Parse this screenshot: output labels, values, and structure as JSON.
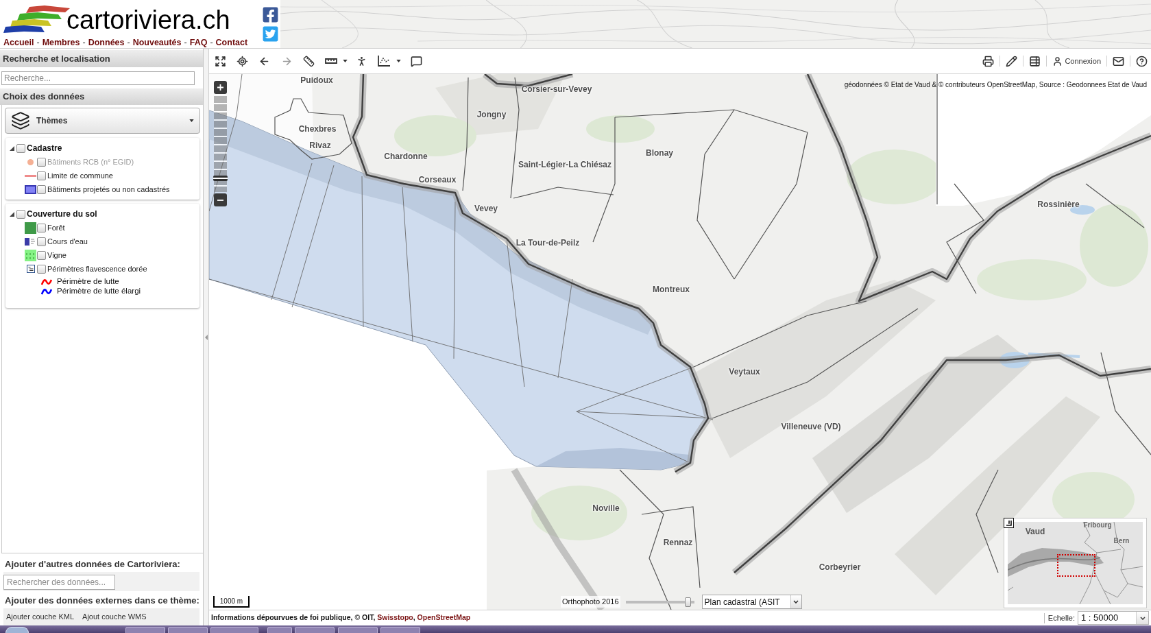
{
  "header": {
    "site_title": "cartoriviera.ch",
    "nav": [
      {
        "kind": "link",
        "label": "Accueil"
      },
      {
        "kind": "separator",
        "label": "-"
      },
      {
        "kind": "link",
        "label": "Membres"
      },
      {
        "kind": "separator",
        "label": "-"
      },
      {
        "kind": "link",
        "label": "Données"
      },
      {
        "kind": "separator",
        "label": "-"
      },
      {
        "kind": "link",
        "label": "Nouveautés"
      },
      {
        "kind": "separator",
        "label": "-"
      },
      {
        "kind": "link",
        "label": "FAQ"
      },
      {
        "kind": "separator",
        "label": "-"
      },
      {
        "kind": "link",
        "label": "Contact"
      }
    ]
  },
  "sidebar": {
    "search_panel": {
      "title": "Recherche et localisation",
      "search": {
        "placeholder": "Recherche..."
      }
    },
    "data_panel": {
      "title": "Choix des données",
      "themes_button": "Thèmes",
      "groups": [
        {
          "label": "Cadastre",
          "checked": false,
          "expanded": true,
          "children": [
            {
              "kind": "dot",
              "label": "Bâtiments RCB (n° EGID)",
              "color": "#f5b094",
              "checked": false,
              "disabled": true
            },
            {
              "kind": "line",
              "label": "Limite de commune",
              "color": "#ef8c8c",
              "checked": false,
              "disabled": false
            },
            {
              "kind": "outlined_fill",
              "label": "Bâtiments projetés ou non cadastrés",
              "color": "#8282f5",
              "checked": false,
              "disabled": false
            }
          ]
        },
        {
          "label": "Couverture du sol",
          "checked": false,
          "expanded": true,
          "children": [
            {
              "kind": "fill",
              "label": "Forêt",
              "color": "#3f9a48",
              "checked": false,
              "disabled": false
            },
            {
              "kind": "water",
              "label": "Cours d'eau",
              "color": "#3c3ca8",
              "checked": false,
              "disabled": false
            },
            {
              "kind": "vine",
              "label": "Vigne",
              "color": "#85f285",
              "checked": false,
              "disabled": false
            },
            {
              "kind": "legend",
              "label": "Périmètres flavescence dorée",
              "checked": false,
              "disabled": false,
              "children": [
                {
                  "label": "Périmètre de lutte",
                  "color": "#ff0000"
                },
                {
                  "label": "Périmètre de lutte élargi",
                  "color": "#0000ff"
                }
              ]
            }
          ]
        }
      ]
    },
    "add_data": {
      "title": "Ajouter d'autres données de Cartoriviera:",
      "search": {
        "placeholder": "Rechercher des données..."
      }
    },
    "external_data": {
      "title": "Ajouter des données externes dans ce thème:",
      "buttons": [
        "Ajouter couche KML",
        "Ajout couche WMS"
      ]
    }
  },
  "toolbar": {
    "login": "Connexion"
  },
  "map": {
    "attribution": "géodonnées © Etat de Vaud & © contributeurs OpenStreetMap, Source : Geodonnees Etat de Vaud",
    "zoom": {
      "level": 0.12
    },
    "place_labels": [
      {
        "name": "Puidoux"
      },
      {
        "name": "Corsier-sur-Vevey"
      },
      {
        "name": "Jongny"
      },
      {
        "name": "Chexbres"
      },
      {
        "name": "Blonay"
      },
      {
        "name": "Chardonne"
      },
      {
        "name": "Rivaz"
      },
      {
        "name": "Saint-Légier-La Chiésaz"
      },
      {
        "name": "Corseaux"
      },
      {
        "name": "Rossinière"
      },
      {
        "name": "Vevey"
      },
      {
        "name": "La Tour-de-Peilz"
      },
      {
        "name": "Montreux"
      },
      {
        "name": "Veytaux"
      },
      {
        "name": "Villeneuve (VD)"
      },
      {
        "name": "Noville"
      },
      {
        "name": "Rennaz"
      },
      {
        "name": "Corbeyrier"
      }
    ],
    "scale_bar": "1000 m",
    "orthophoto": {
      "label": "Orthophoto 2016",
      "level": 0.95
    },
    "base_layer": "Plan cadastral (ASIT",
    "overview": {
      "labels": [
        "Vaud",
        "Fribourg",
        "Bern"
      ]
    }
  },
  "footer": {
    "disclaimer": [
      {
        "kind": "text",
        "text": "Informations dépourvues de foi publique, © OIT, "
      },
      {
        "kind": "link",
        "text": "Swisstopo"
      },
      {
        "kind": "text",
        "text": ", "
      },
      {
        "kind": "link",
        "text": "OpenStreetMap"
      }
    ],
    "scale": {
      "label": "Echelle:",
      "value": "1 : 50000"
    }
  }
}
